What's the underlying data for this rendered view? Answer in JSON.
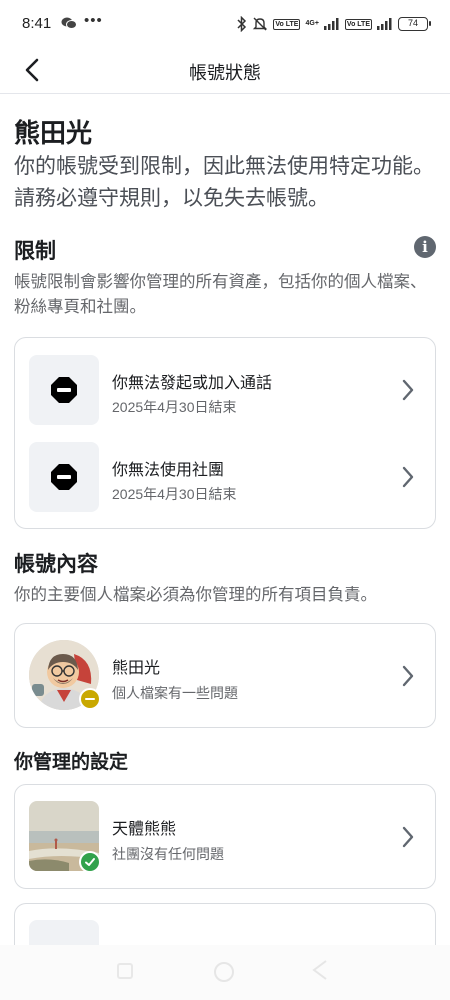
{
  "status_bar": {
    "time": "8:41",
    "dots": "•••",
    "network": "4G+",
    "volte": "Vo LTE",
    "battery": "74"
  },
  "nav": {
    "title": "帳號狀態",
    "back_icon": "chevron-left-icon"
  },
  "account": {
    "name": "熊田光",
    "intro": "你的帳號受到限制，因此無法使用特定功能。請務必遵守規則，以免失去帳號。"
  },
  "restrictions": {
    "heading": "限制",
    "description": "帳號限制會影響你管理的所有資產，包括你的個人檔案、粉絲專頁和社團。",
    "items": [
      {
        "title": "你無法發起或加入通話",
        "subtitle": "2025年4月30日結束",
        "icon": "blocked-icon"
      },
      {
        "title": "你無法使用社團",
        "subtitle": "2025年4月30日結束",
        "icon": "blocked-icon"
      }
    ]
  },
  "account_content": {
    "heading": "帳號內容",
    "description": "你的主要個人檔案必須為你管理的所有項目負責。",
    "profile": {
      "name": "熊田光",
      "status": "個人檔案有一些問題"
    }
  },
  "managed": {
    "heading": "你管理的設定",
    "items": [
      {
        "name": "天體熊熊",
        "status": "社團沒有任何問題"
      }
    ]
  },
  "colors": {
    "warning_badge": "#c9a800",
    "ok_badge": "#31a24c",
    "card_border": "#dadde1"
  }
}
